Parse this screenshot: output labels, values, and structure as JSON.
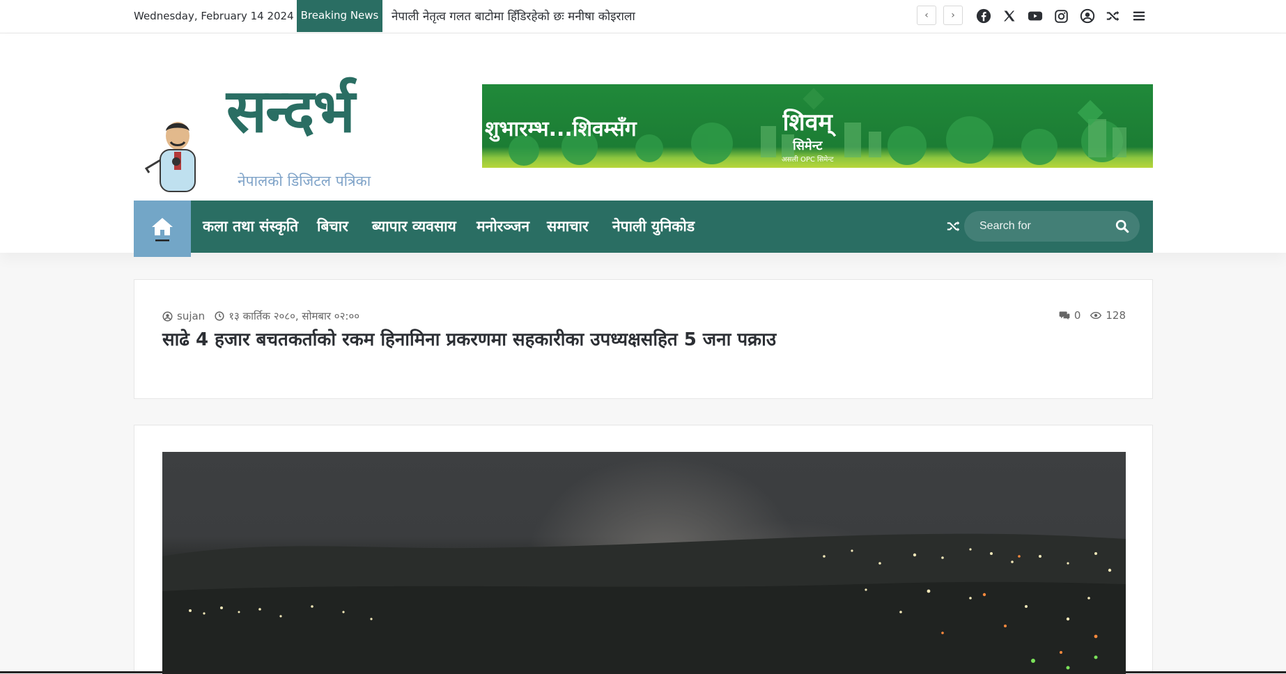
{
  "topbar": {
    "date": "Wednesday, February 14 2024",
    "breaking_label": "Breaking News",
    "ticker_text": "नेपाली नेतृत्व गलत बाटोमा हिँडिरहेको छः मनीषा कोइराला",
    "prev_symbol": "‹",
    "next_symbol": "›",
    "icons": [
      "facebook-icon",
      "x-icon",
      "youtube-icon",
      "instagram-icon",
      "user-icon",
      "shuffle-icon",
      "menu-icon"
    ]
  },
  "header": {
    "logo_text": "सन्दर्भ",
    "logo_tagline": "नेपालको डिजिटल पत्रिका",
    "banner": {
      "left_text": "शुभारम्भ...शिवम्सँग",
      "brand": "शिवम्",
      "sub": "सिमेन्ट",
      "small": "असली OPC सिमेन्ट"
    }
  },
  "nav": {
    "items": [
      "कला तथा संस्कृति",
      "बिचार",
      "ब्यापार व्यवसाय",
      "मनोरञ्जन",
      "समाचार",
      "नेपाली युनिकोड"
    ],
    "search_placeholder": "Search for"
  },
  "article": {
    "author": "sujan",
    "date": "१३ कार्तिक २०८०, सोमबार ०२:००",
    "comments": "0",
    "views": "128",
    "title": "साढे 4 हजार बचतकर्ताको रकम हिनामिना प्रकरणमा सहकारीका उपध्यक्षसहित 5 जना पक्राउ"
  },
  "colors": {
    "accent": "#2a6e63",
    "home_tab": "#73a6c7",
    "banner_green": "#20893a",
    "logo_blue": "#7fa3c8"
  }
}
